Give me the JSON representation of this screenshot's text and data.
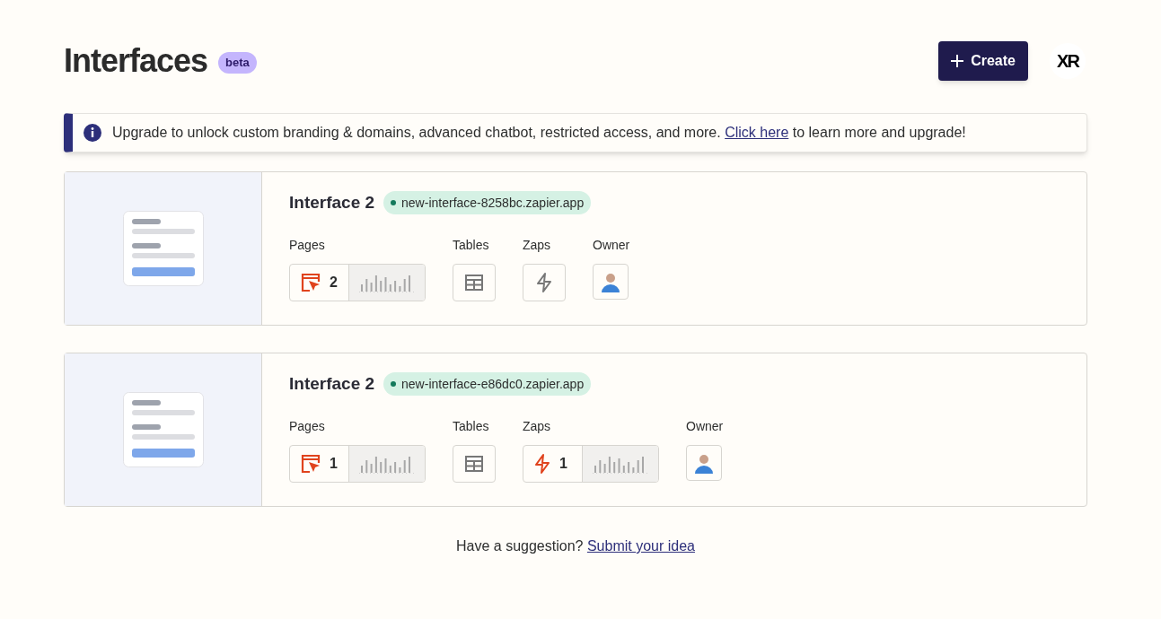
{
  "header": {
    "title": "Interfaces",
    "badge": "beta",
    "create_button": "Create",
    "logo": "XR"
  },
  "banner": {
    "text_before": "Upgrade to unlock custom branding & domains, advanced chatbot, restricted access, and more.",
    "link": "Click here",
    "text_after": "to learn more and upgrade!"
  },
  "interfaces": [
    {
      "name": "Interface 2",
      "url": "new-interface-8258bc.zapier.app",
      "pages_label": "Pages",
      "pages_count": "2",
      "tables_label": "Tables",
      "zaps_label": "Zaps",
      "owner_label": "Owner"
    },
    {
      "name": "Interface 2",
      "url": "new-interface-e86dc0.zapier.app",
      "pages_label": "Pages",
      "pages_count": "1",
      "tables_label": "Tables",
      "zaps_label": "Zaps",
      "zaps_count": "1",
      "owner_label": "Owner"
    }
  ],
  "footer": {
    "text": "Have a suggestion?",
    "link": "Submit your idea"
  }
}
